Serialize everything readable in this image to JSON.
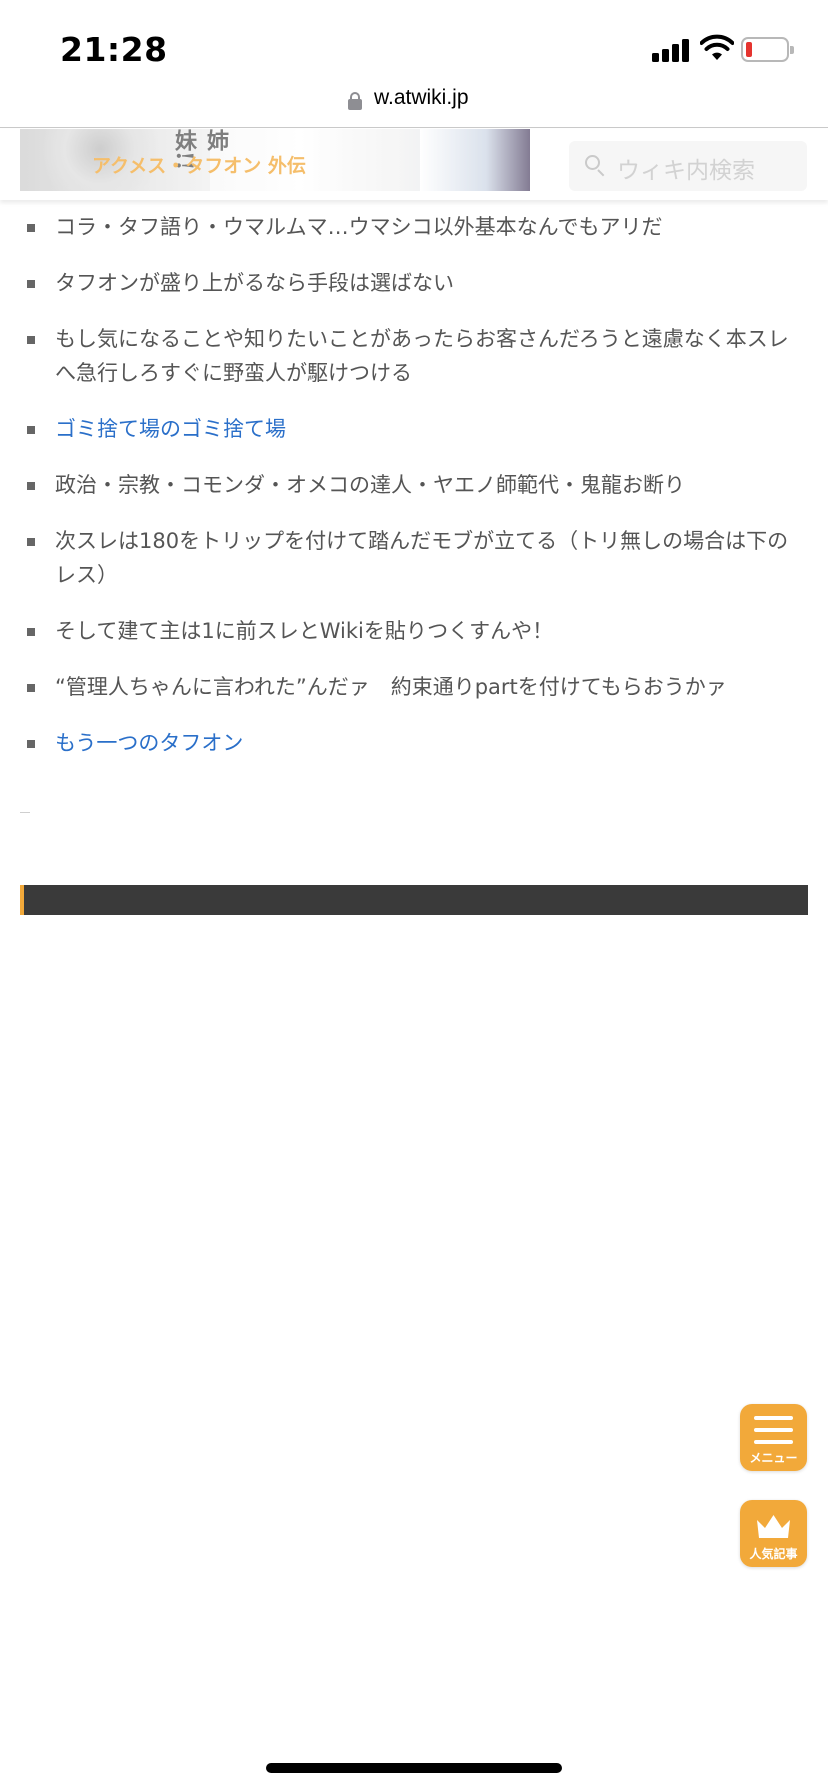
{
  "status_bar": {
    "time": "21:28"
  },
  "url_bar": {
    "domain": "w.atwiki.jp"
  },
  "header": {
    "banner_art_text": "姉妹!!",
    "banner_title": "アクメス・タフオン 外伝",
    "search_placeholder": "ウィキ内検索"
  },
  "rules": [
    {
      "text": "コラ・タフ語り・ウマルムマ…ウマシコ以外基本なんでもアリだ",
      "link": false
    },
    {
      "text": "タフオンが盛り上がるなら手段は選ばない",
      "link": false
    },
    {
      "text": "もし気になることや知りたいことがあったらお客さんだろうと遠慮なく本スレへ急行しろすぐに野蛮人が駆けつける",
      "link": false
    },
    {
      "text": "ゴミ捨て場のゴミ捨て場",
      "link": true
    },
    {
      "text": "政治・宗教・コモンダ・オメコの達人・ヤエノ師範代・鬼龍お断り",
      "link": false
    },
    {
      "text": "次スレは180をトリップを付けて踏んだモブが立てる（トリ無しの場合は下のレス）",
      "link": false
    },
    {
      "text": "そして建て主は1に前スレとWikiを貼りつくすんや！",
      "link": false
    },
    {
      "text": "“管理人ちゃんに言われた”んだァ　約束通りpartを付けてもらおうかァ",
      "link": false
    },
    {
      "text": "もう一つのタフオン",
      "link": true
    }
  ],
  "fab": {
    "menu_label": "メニュー",
    "rank_label": "人気記事"
  },
  "colors": {
    "accent": "#f2a93a",
    "link": "#2a6fc9",
    "text": "#555555",
    "section_header_bg": "#3a3a3a",
    "battery_low": "#e5342f"
  },
  "icons": {
    "lock": "lock-icon",
    "search": "search-icon",
    "menu": "hamburger-menu-icon",
    "ranking": "crown-icon"
  }
}
